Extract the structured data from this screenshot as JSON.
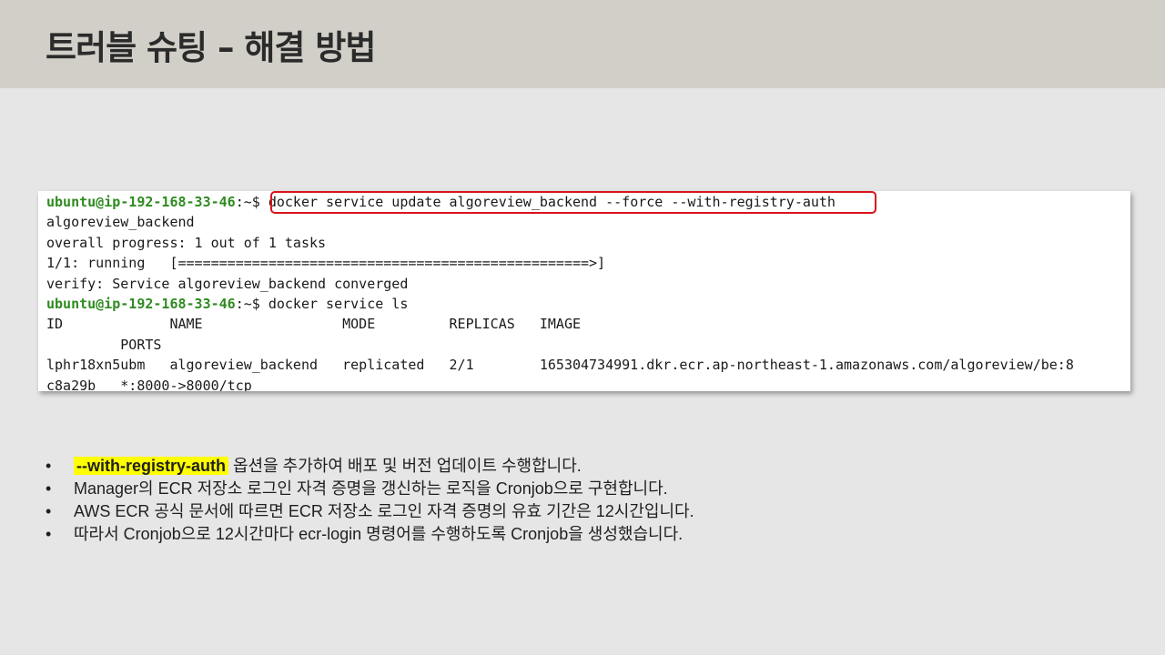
{
  "slide": {
    "title": "트러블 슈팅 – 해결 방법"
  },
  "terminal": {
    "prompt_user_host": "ubuntu@ip-192-168-33-46",
    "prompt_suffix": ":~$ ",
    "command_1": "docker service update algoreview_backend --force --with-registry-auth",
    "output": [
      "algoreview_backend",
      "overall progress: 1 out of 1 tasks",
      "1/1: running   [==================================================>]",
      "verify: Service algoreview_backend converged"
    ],
    "command_2": "docker service ls",
    "table": {
      "header_line_1": "ID             NAME                 MODE         REPLICAS   IMAGE",
      "header_line_2": "         PORTS",
      "row_line_1": "lphr18xn5ubm   algoreview_backend   replicated   2/1        165304734991.dkr.ecr.ap-northeast-1.amazonaws.com/algoreview/be:8",
      "row_line_2": "c8a29b   *:8000->8000/tcp"
    }
  },
  "bullets": {
    "marker": "•",
    "item_1_flag": "--with-registry-auth",
    "item_1_rest": " 옵션을 추가하여 배포 및 버전 업데이트 수행합니다.",
    "item_2": "Manager의 ECR 저장소 로그인 자격 증명을 갱신하는 로직을 Cronjob으로 구현합니다.",
    "item_3": "AWS ECR 공식 문서에 따르면 ECR 저장소 로그인 자격 증명의 유효 기간은 12시간입니다.",
    "item_4": "따라서 Cronjob으로 12시간마다 ecr-login 명령어를 수행하도록 Cronjob을 생성했습니다."
  },
  "colors": {
    "header_bg": "#d2cfc8",
    "page_bg": "#e6e6e6",
    "prompt_green": "#2e8b1f",
    "command_outline_red": "#d9141b",
    "flag_highlight_yellow": "#ffff00"
  }
}
